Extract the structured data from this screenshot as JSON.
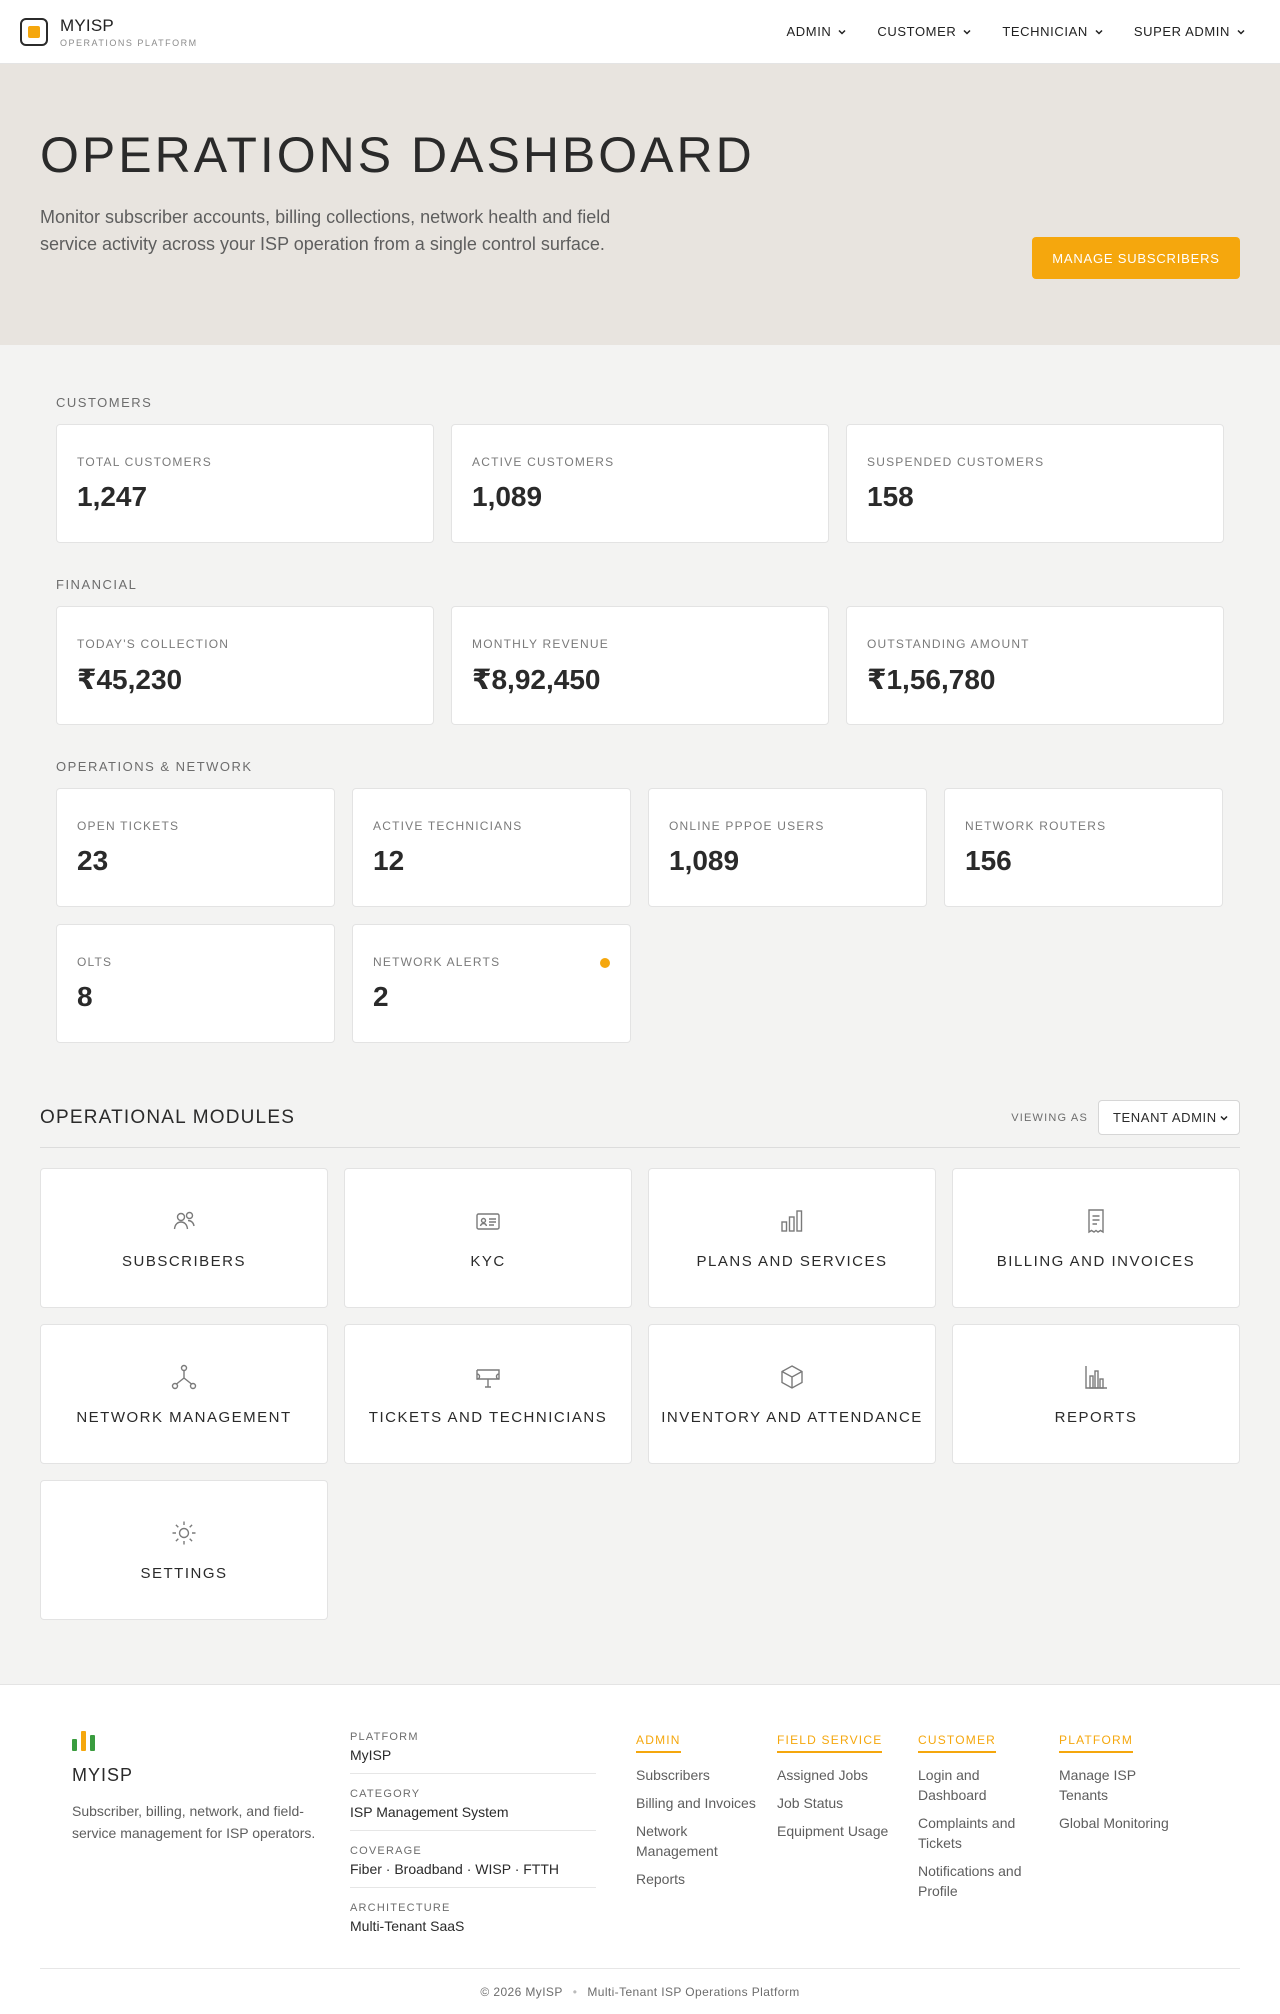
{
  "header": {
    "brand_name": "MYISP",
    "brand_tag": "OPERATIONS PLATFORM",
    "nav": [
      "ADMIN",
      "CUSTOMER",
      "TECHNICIAN",
      "SUPER ADMIN"
    ]
  },
  "hero": {
    "title": "OPERATIONS DASHBOARD",
    "description": "Monitor subscriber accounts, billing collections, network health and field service activity across your ISP operation from a single control surface.",
    "cta": "MANAGE SUBSCRIBERS"
  },
  "customers": {
    "section": "CUSTOMERS",
    "cards": [
      {
        "label": "TOTAL CUSTOMERS",
        "value": "1,247"
      },
      {
        "label": "ACTIVE CUSTOMERS",
        "value": "1,089"
      },
      {
        "label": "SUSPENDED CUSTOMERS",
        "value": "158"
      }
    ]
  },
  "financial": {
    "section": "FINANCIAL",
    "cards": [
      {
        "label": "TODAY'S COLLECTION",
        "value": "₹45,230"
      },
      {
        "label": "MONTHLY REVENUE",
        "value": "₹8,92,450"
      },
      {
        "label": "OUTSTANDING AMOUNT",
        "value": "₹1,56,780"
      }
    ]
  },
  "operations": {
    "section": "OPERATIONS & NETWORK",
    "cards": [
      {
        "label": "OPEN TICKETS",
        "value": "23"
      },
      {
        "label": "ACTIVE TECHNICIANS",
        "value": "12"
      },
      {
        "label": "ONLINE PPPOE USERS",
        "value": "1,089"
      },
      {
        "label": "NETWORK ROUTERS",
        "value": "156"
      },
      {
        "label": "OLTS",
        "value": "8"
      },
      {
        "label": "NETWORK ALERTS",
        "value": "2"
      }
    ]
  },
  "modules": {
    "title": "OPERATIONAL MODULES",
    "viewing_label": "VIEWING AS",
    "viewing_value": "TENANT ADMIN",
    "items": [
      {
        "label": "SUBSCRIBERS",
        "icon": "users-icon"
      },
      {
        "label": "KYC",
        "icon": "id-card-icon"
      },
      {
        "label": "PLANS AND SERVICES",
        "icon": "bar-chart-icon"
      },
      {
        "label": "BILLING AND INVOICES",
        "icon": "receipt-icon"
      },
      {
        "label": "NETWORK MANAGEMENT",
        "icon": "network-icon"
      },
      {
        "label": "TICKETS AND TECHNICIANS",
        "icon": "ticket-icon"
      },
      {
        "label": "INVENTORY AND ATTENDANCE",
        "icon": "box-icon"
      },
      {
        "label": "REPORTS",
        "icon": "reports-icon"
      },
      {
        "label": "SETTINGS",
        "icon": "settings-icon"
      }
    ]
  },
  "footer": {
    "brand_name": "MYISP",
    "description": "Subscriber, billing, network, and field-service management for ISP operators.",
    "meta": [
      {
        "label": "PLATFORM",
        "value": "MyISP"
      },
      {
        "label": "CATEGORY",
        "value": "ISP Management System"
      },
      {
        "label": "COVERAGE",
        "value": "Fiber · Broadband · WISP · FTTH"
      },
      {
        "label": "ARCHITECTURE",
        "value": "Multi-Tenant SaaS"
      }
    ],
    "columns": [
      {
        "title": "ADMIN",
        "links": [
          "Subscribers",
          "Billing and Invoices",
          "Network Management",
          "Reports"
        ]
      },
      {
        "title": "FIELD SERVICE",
        "links": [
          "Assigned Jobs",
          "Job Status",
          "Equipment Usage"
        ]
      },
      {
        "title": "CUSTOMER",
        "links": [
          "Login and Dashboard",
          "Complaints and Tickets",
          "Notifications and Profile"
        ]
      },
      {
        "title": "PLATFORM",
        "links": [
          "Manage ISP Tenants",
          "Global Monitoring"
        ]
      }
    ],
    "copyright": "© 2026 MyISP",
    "tagline": "Multi-Tenant ISP Operations Platform"
  },
  "colors": {
    "accent": "#f5a70d",
    "hero_bg": "#e8e4df",
    "bar_green": "#3a9c3f",
    "bar_yellow": "#f5a70d"
  }
}
